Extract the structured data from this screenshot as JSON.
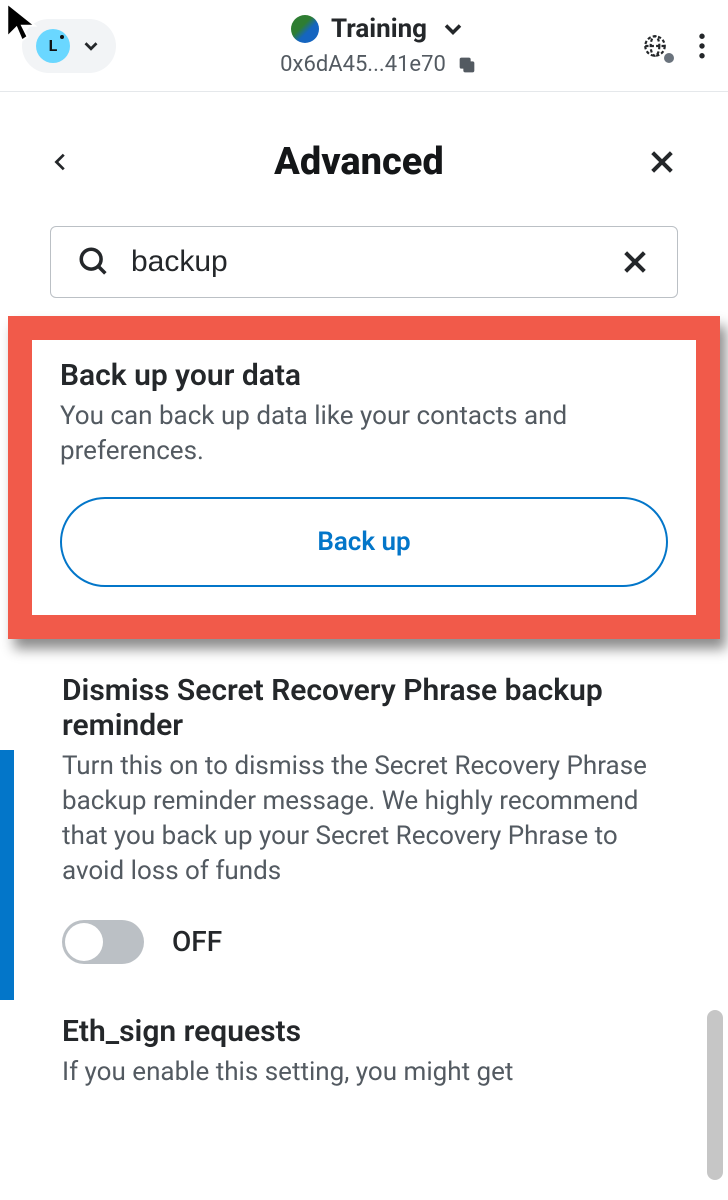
{
  "header": {
    "account_letter": "L",
    "network": "Training",
    "address": "0x6dA45...41e70"
  },
  "page": {
    "title": "Advanced"
  },
  "search": {
    "value": "backup"
  },
  "backup_section": {
    "title": "Back up your data",
    "desc": "You can back up data like your contacts and preferences.",
    "button": "Back up"
  },
  "dismiss_section": {
    "title": "Dismiss Secret Recovery Phrase backup reminder",
    "desc": "Turn this on to dismiss the Secret Recovery Phrase backup reminder message. We highly recommend that you back up your Secret Recovery Phrase to avoid loss of funds",
    "toggle_state": "OFF"
  },
  "ethsign_section": {
    "title": "Eth_sign requests",
    "desc_partial": "If you enable this setting, you might get"
  }
}
